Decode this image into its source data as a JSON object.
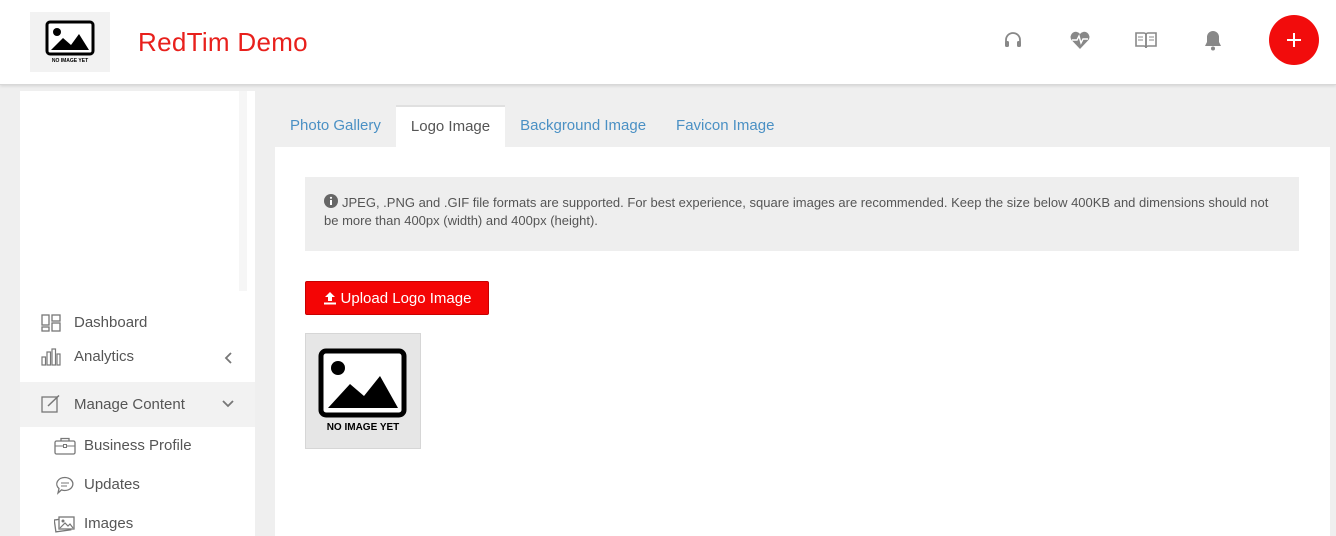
{
  "header": {
    "brand_name": "RedTim Demo",
    "logo_caption": "NO IMAGE YET",
    "icons": [
      "headset-icon",
      "heart-pulse-icon",
      "book-icon",
      "bell-icon"
    ],
    "add_icon": "plus-icon",
    "accent_color": "#e8201c"
  },
  "sidebar": {
    "items": [
      {
        "label": "Dashboard",
        "icon": "dashboard-icon"
      },
      {
        "label": "Analytics",
        "icon": "bar-chart-icon"
      },
      {
        "label": "Manage Content",
        "icon": "edit-icon"
      }
    ],
    "sub_items": [
      {
        "label": "Business Profile",
        "icon": "briefcase-icon"
      },
      {
        "label": "Updates",
        "icon": "chat-bubble-icon"
      },
      {
        "label": "Images",
        "icon": "images-icon"
      }
    ]
  },
  "tabs": [
    {
      "label": "Photo Gallery"
    },
    {
      "label": "Logo Image",
      "active": true
    },
    {
      "label": "Background Image"
    },
    {
      "label": "Favicon Image"
    }
  ],
  "main": {
    "notice": "JPEG, .PNG and .GIF file formats are supported. For best experience, square images are recommended. Keep the size below 400KB and dimensions should not be more than 400px (width) and 400px (height).",
    "upload_label": "Upload Logo Image",
    "preview_caption": "NO IMAGE YET"
  }
}
